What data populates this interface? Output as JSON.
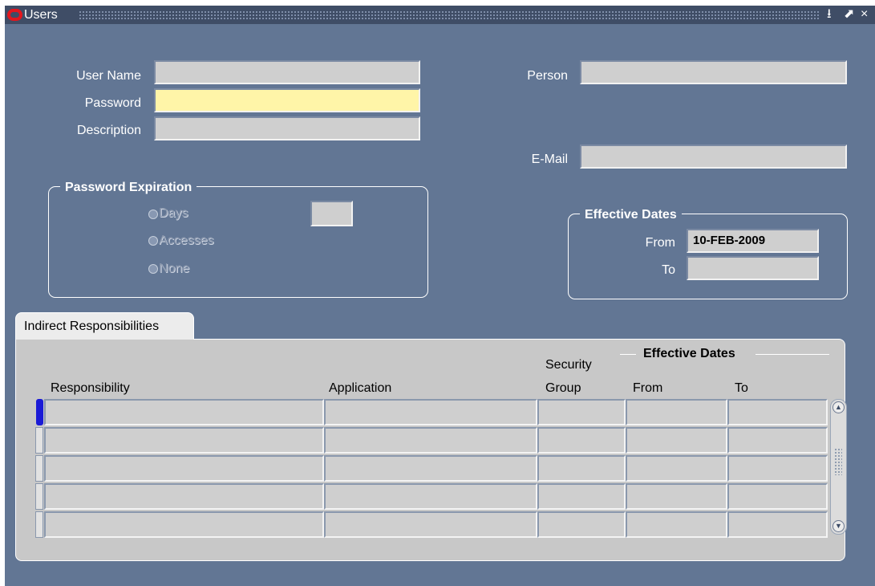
{
  "window": {
    "title": "Users",
    "controls": {
      "minimize": "⭳",
      "maximize": "⬈",
      "close": "×"
    }
  },
  "form": {
    "user_name": {
      "label": "User Name",
      "value": ""
    },
    "password": {
      "label": "Password",
      "value": ""
    },
    "description": {
      "label": "Description",
      "value": ""
    },
    "person": {
      "label": "Person",
      "value": ""
    },
    "email": {
      "label": "E-Mail",
      "value": ""
    }
  },
  "password_expiration": {
    "title": "Password Expiration",
    "options": [
      "Days",
      "Accesses",
      "None"
    ],
    "days_value": ""
  },
  "effective_dates": {
    "title": "Effective Dates",
    "from_label": "From",
    "from_value": "10-FEB-2009",
    "to_label": "To",
    "to_value": ""
  },
  "tabs": {
    "indirect": "Indirect Responsibilities"
  },
  "table": {
    "group_header": "Effective Dates",
    "columns": {
      "responsibility": "Responsibility",
      "application": "Application",
      "security_line1": "Security",
      "security_line2": "Group",
      "from": "From",
      "to": "To"
    },
    "rows": [
      {
        "responsibility": "",
        "application": "",
        "security_group": "",
        "from": "",
        "to": ""
      },
      {
        "responsibility": "",
        "application": "",
        "security_group": "",
        "from": "",
        "to": ""
      },
      {
        "responsibility": "",
        "application": "",
        "security_group": "",
        "from": "",
        "to": ""
      },
      {
        "responsibility": "",
        "application": "",
        "security_group": "",
        "from": "",
        "to": ""
      },
      {
        "responsibility": "",
        "application": "",
        "security_group": "",
        "from": "",
        "to": ""
      }
    ]
  },
  "icons": {
    "logo": "oracle-logo-icon",
    "scroll_up": "scroll-up-icon",
    "scroll_down": "scroll-down-icon"
  },
  "colors": {
    "background": "#627694",
    "titlebar": "#3f4d66",
    "field": "#cfcfcf",
    "required_field": "#fff5a8",
    "current_row": "#1a1ad6"
  }
}
